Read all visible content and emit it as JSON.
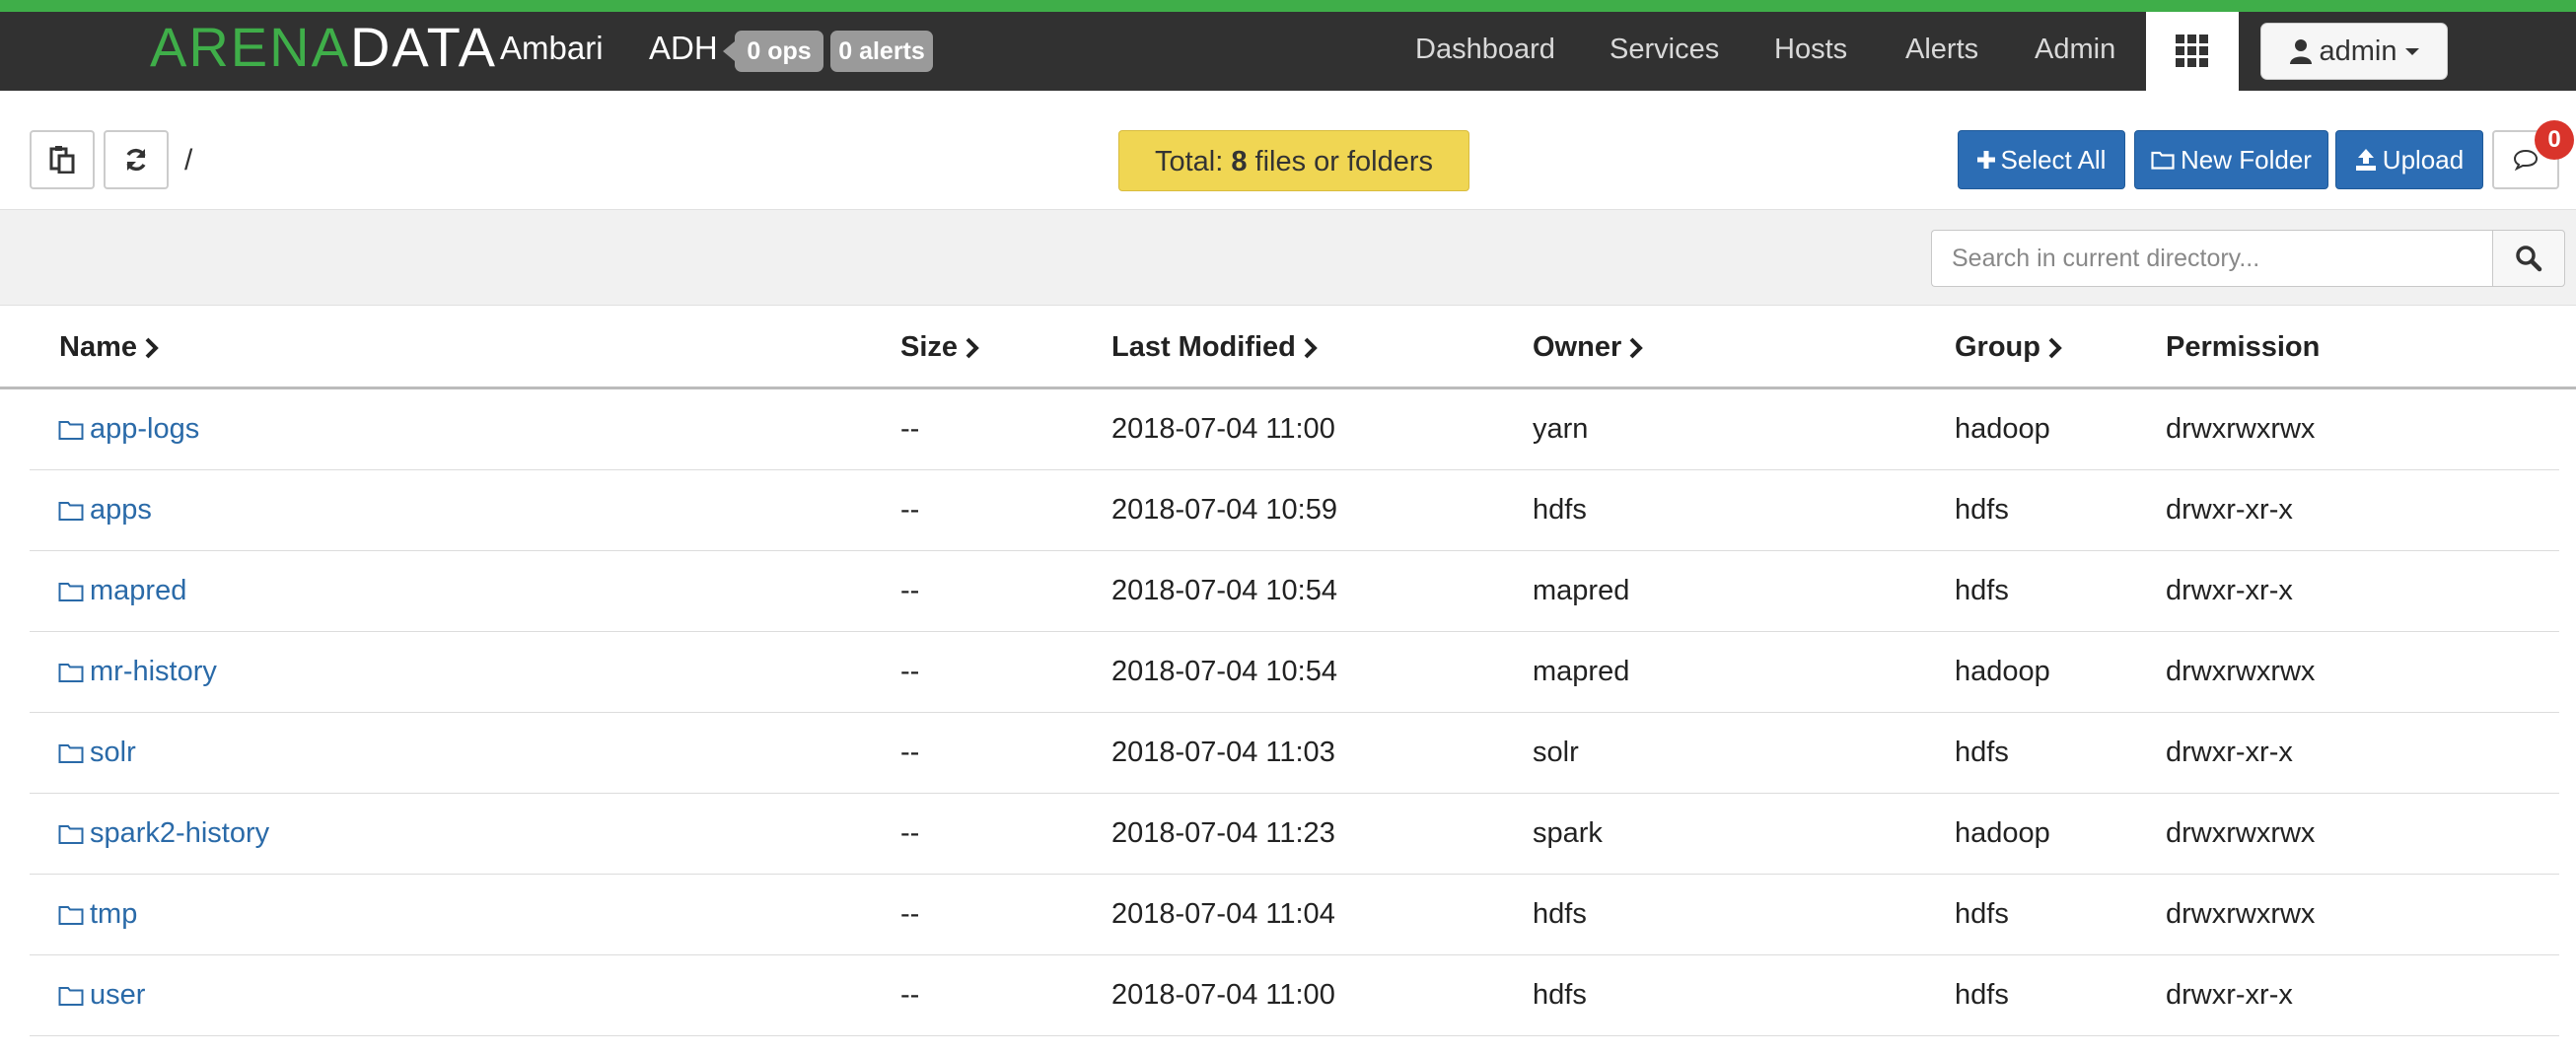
{
  "navbar": {
    "logo_part1": "ARENA",
    "logo_part2": "DATA",
    "app_name": "Ambari",
    "cluster_name": "ADH",
    "ops_badge": "0 ops",
    "alerts_badge": "0 alerts",
    "links": [
      "Dashboard",
      "Services",
      "Hosts",
      "Alerts",
      "Admin"
    ],
    "user": "admin",
    "accent_color": "#3fae49"
  },
  "toolbar": {
    "path": "/",
    "total_prefix": "Total: ",
    "total_count": "8",
    "total_suffix": " files or folders",
    "select_all": "Select All",
    "new_folder": "New Folder",
    "upload": "Upload",
    "notification_count": "0",
    "button_color": "#2c6db4"
  },
  "search": {
    "placeholder": "Search in current directory..."
  },
  "table": {
    "headers": {
      "name": "Name",
      "size": "Size",
      "modified": "Last Modified",
      "owner": "Owner",
      "group": "Group",
      "permission": "Permission"
    },
    "rows": [
      {
        "name": "app-logs",
        "size": "--",
        "modified": "2018-07-04 11:00",
        "owner": "yarn",
        "group": "hadoop",
        "permission": "drwxrwxrwx"
      },
      {
        "name": "apps",
        "size": "--",
        "modified": "2018-07-04 10:59",
        "owner": "hdfs",
        "group": "hdfs",
        "permission": "drwxr-xr-x"
      },
      {
        "name": "mapred",
        "size": "--",
        "modified": "2018-07-04 10:54",
        "owner": "mapred",
        "group": "hdfs",
        "permission": "drwxr-xr-x"
      },
      {
        "name": "mr-history",
        "size": "--",
        "modified": "2018-07-04 10:54",
        "owner": "mapred",
        "group": "hadoop",
        "permission": "drwxrwxrwx"
      },
      {
        "name": "solr",
        "size": "--",
        "modified": "2018-07-04 11:03",
        "owner": "solr",
        "group": "hdfs",
        "permission": "drwxr-xr-x"
      },
      {
        "name": "spark2-history",
        "size": "--",
        "modified": "2018-07-04 11:23",
        "owner": "spark",
        "group": "hadoop",
        "permission": "drwxrwxrwx"
      },
      {
        "name": "tmp",
        "size": "--",
        "modified": "2018-07-04 11:04",
        "owner": "hdfs",
        "group": "hdfs",
        "permission": "drwxrwxrwx"
      },
      {
        "name": "user",
        "size": "--",
        "modified": "2018-07-04 11:00",
        "owner": "hdfs",
        "group": "hdfs",
        "permission": "drwxr-xr-x"
      }
    ]
  }
}
